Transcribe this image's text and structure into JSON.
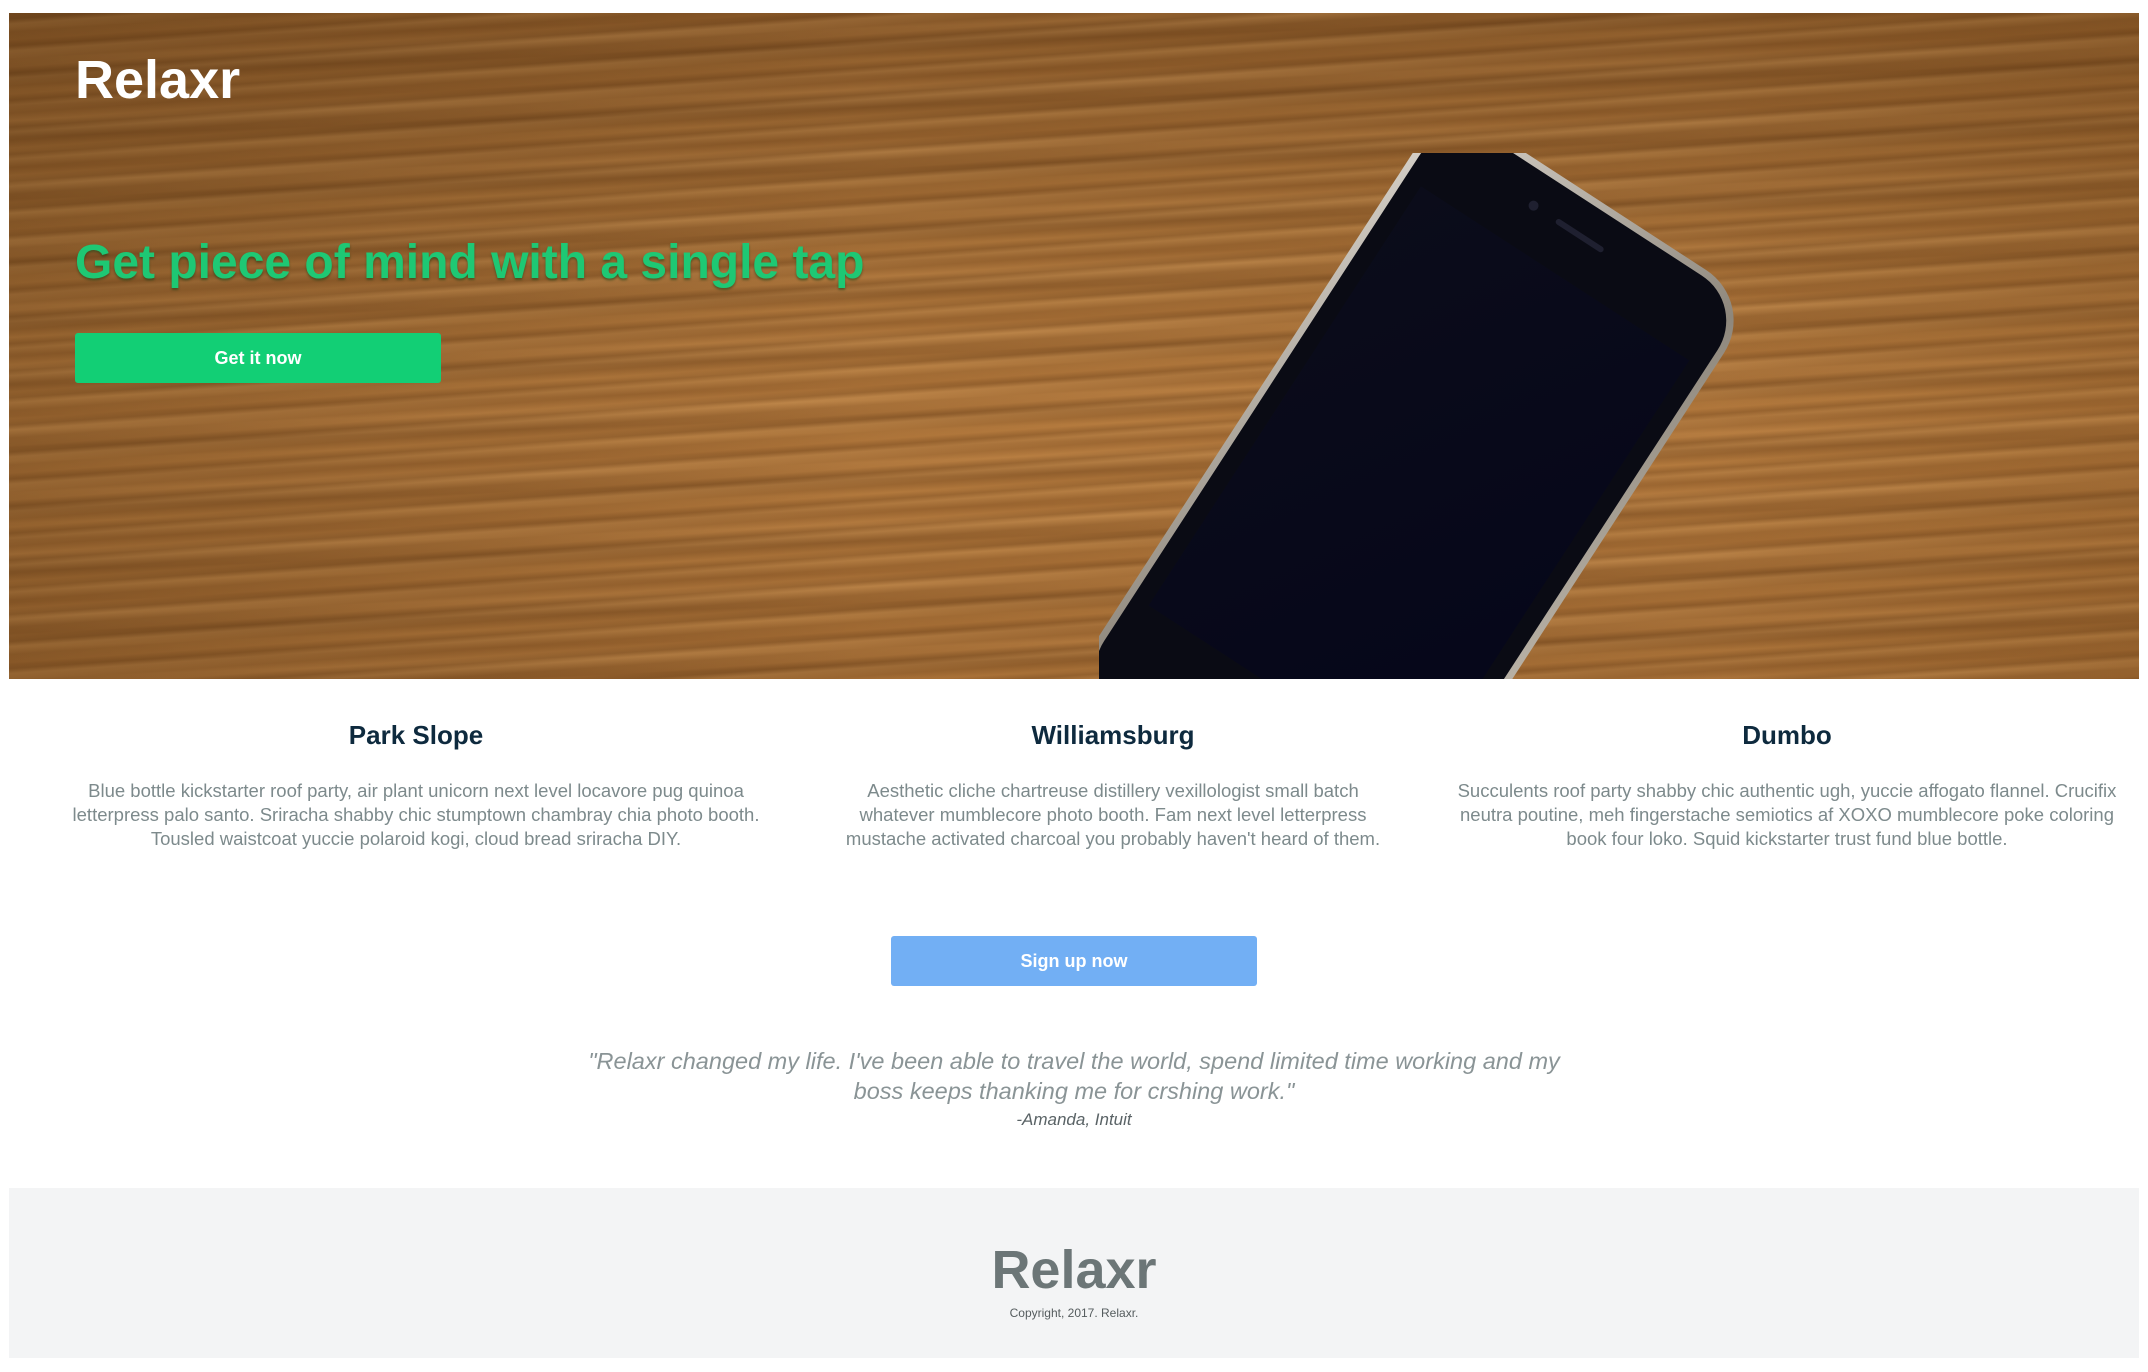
{
  "hero": {
    "brand": "Relaxr",
    "headline": "Get piece of mind with a single tap",
    "cta_label": "Get it now"
  },
  "features": [
    {
      "title": "Park Slope",
      "text": "Blue bottle kickstarter roof party, air plant unicorn next level locavore pug quinoa letterpress palo santo. Sriracha shabby chic stumptown chambray chia photo booth. Tousled waistcoat yuccie polaroid kogi, cloud bread sriracha DIY."
    },
    {
      "title": "Williamsburg",
      "text": "Aesthetic cliche chartreuse distillery vexillologist small batch whatever mumblecore photo booth. Fam next level letterpress mustache activated charcoal you probably haven't heard of them."
    },
    {
      "title": "Dumbo",
      "text": "Succulents roof party shabby chic authentic ugh, yuccie affogato flannel. Crucifix neutra poutine, meh fingerstache semiotics af XOXO mumblecore poke coloring book four loko. Squid kickstarter trust fund blue bottle."
    }
  ],
  "signup_label": "Sign up now",
  "testimonial": {
    "quote": "\"Relaxr changed my life. I've been able to travel the world, spend limited time working and my boss keeps thanking me for crshing work.\"",
    "author": "-Amanda, Intuit"
  },
  "footer": {
    "brand": "Relaxr",
    "copyright": "Copyright, 2017. Relaxr."
  },
  "colors": {
    "headline_green": "#1ec874",
    "cta_green": "#12cf75",
    "signup_blue": "#72aff4",
    "feature_title": "#0e2a3e",
    "footer_bg": "#f3f4f5"
  }
}
